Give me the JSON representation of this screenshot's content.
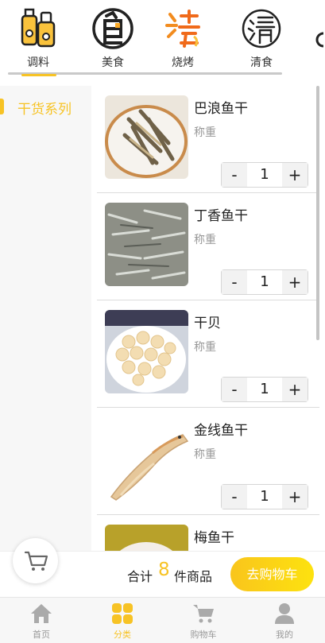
{
  "categories": [
    {
      "label": "调料",
      "icon": "seasoning-bottles-icon"
    },
    {
      "label": "美食",
      "icon": "food-character-icon"
    },
    {
      "label": "烧烤",
      "icon": "bbq-flame-character-icon"
    },
    {
      "label": "清食",
      "icon": "clear-food-character-icon"
    }
  ],
  "sidebar": {
    "items": [
      {
        "label": "干货系列",
        "active": true
      }
    ]
  },
  "products": [
    {
      "name": "巴浪鱼干",
      "unit": "称重",
      "qty": "1",
      "minus": "-",
      "plus": "+"
    },
    {
      "name": "丁香鱼干",
      "unit": "称重",
      "qty": "1",
      "minus": "-",
      "plus": "+"
    },
    {
      "name": "干贝",
      "unit": "称重",
      "qty": "1",
      "minus": "-",
      "plus": "+"
    },
    {
      "name": "金线鱼干",
      "unit": "称重",
      "qty": "1",
      "minus": "-",
      "plus": "+"
    },
    {
      "name": "梅鱼干",
      "unit": "",
      "qty": "",
      "minus": "",
      "plus": ""
    }
  ],
  "cart": {
    "total_label": "合计",
    "count": "8",
    "count_unit": "件商品",
    "checkout_label": "去购物车"
  },
  "tabs": [
    {
      "label": "首页",
      "icon": "home-icon",
      "active": false
    },
    {
      "label": "分类",
      "icon": "category-grid-icon",
      "active": true
    },
    {
      "label": "购物车",
      "icon": "shopping-cart-icon",
      "active": false
    },
    {
      "label": "我的",
      "icon": "user-icon",
      "active": false
    }
  ],
  "colors": {
    "accent": "#f7c325",
    "muted": "#999999"
  }
}
